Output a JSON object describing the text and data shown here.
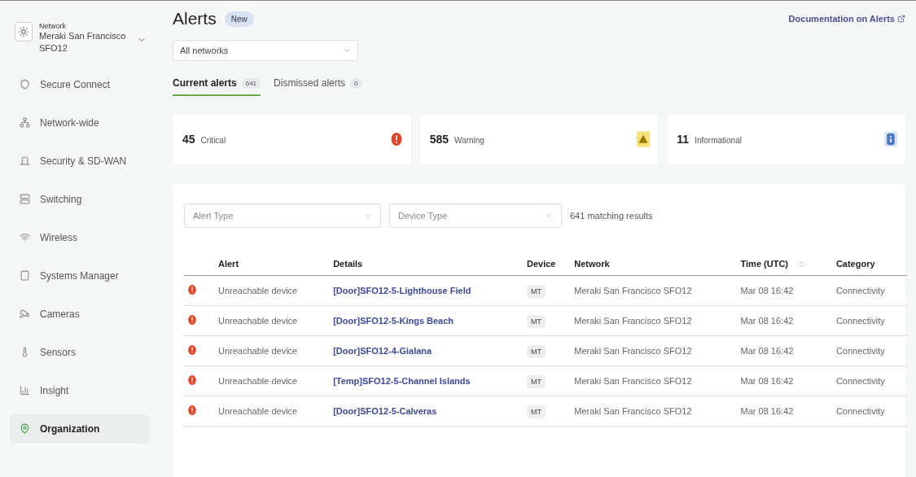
{
  "network_switcher": {
    "label": "Network",
    "name": "Meraki San Francisco SFO12"
  },
  "sidebar": {
    "items": [
      {
        "label": "Secure Connect",
        "selected": false
      },
      {
        "label": "Network-wide",
        "selected": false
      },
      {
        "label": "Security & SD-WAN",
        "selected": false
      },
      {
        "label": "Switching",
        "selected": false
      },
      {
        "label": "Wireless",
        "selected": false
      },
      {
        "label": "Systems Manager",
        "selected": false
      },
      {
        "label": "Cameras",
        "selected": false
      },
      {
        "label": "Sensors",
        "selected": false
      },
      {
        "label": "Insight",
        "selected": false
      },
      {
        "label": "Organization",
        "selected": true
      }
    ]
  },
  "header": {
    "title": "Alerts",
    "badge": "New",
    "doc_link": "Documentation on Alerts"
  },
  "network_select": {
    "value": "All networks"
  },
  "tabs": [
    {
      "label": "Current alerts",
      "count": "641",
      "selected": true
    },
    {
      "label": "Dismissed alerts",
      "count": "0",
      "selected": false
    }
  ],
  "summary_cards": [
    {
      "count": "45",
      "label": "Critical",
      "kind": "critical"
    },
    {
      "count": "585",
      "label": "Warning",
      "kind": "warning"
    },
    {
      "count": "11",
      "label": "Informational",
      "kind": "info"
    }
  ],
  "filters": {
    "alert_type": {
      "placeholder": "Alert Type"
    },
    "device_type": {
      "placeholder": "Device Type"
    },
    "results": "641 matching results"
  },
  "table": {
    "columns": [
      "Alert",
      "Details",
      "Device",
      "Network",
      "Time (UTC)",
      "Category"
    ],
    "rows": [
      {
        "kind": "critical",
        "alert": "Unreachable device",
        "details": "[Door]SFO12-5-Lighthouse Field",
        "device": "MT",
        "network": "Meraki San Francisco SFO12",
        "time": "Mar 08 16:42",
        "category": "Connectivity"
      },
      {
        "kind": "critical",
        "alert": "Unreachable device",
        "details": "[Door]SFO12-5-Kings Beach",
        "device": "MT",
        "network": "Meraki San Francisco SFO12",
        "time": "Mar 08 16:42",
        "category": "Connectivity"
      },
      {
        "kind": "critical",
        "alert": "Unreachable device",
        "details": "[Door]SFO12-4-Gialana",
        "device": "MT",
        "network": "Meraki San Francisco SFO12",
        "time": "Mar 08 16:42",
        "category": "Connectivity"
      },
      {
        "kind": "critical",
        "alert": "Unreachable device",
        "details": "[Temp]SFO12-5-Channel Islands",
        "device": "MT",
        "network": "Meraki San Francisco SFO12",
        "time": "Mar 08 16:42",
        "category": "Connectivity"
      },
      {
        "kind": "critical",
        "alert": "Unreachable device",
        "details": "[Door]SFO12-5-Calveras",
        "device": "MT",
        "network": "Meraki San Francisco SFO12",
        "time": "Mar 08 16:42",
        "category": "Connectivity"
      }
    ]
  }
}
